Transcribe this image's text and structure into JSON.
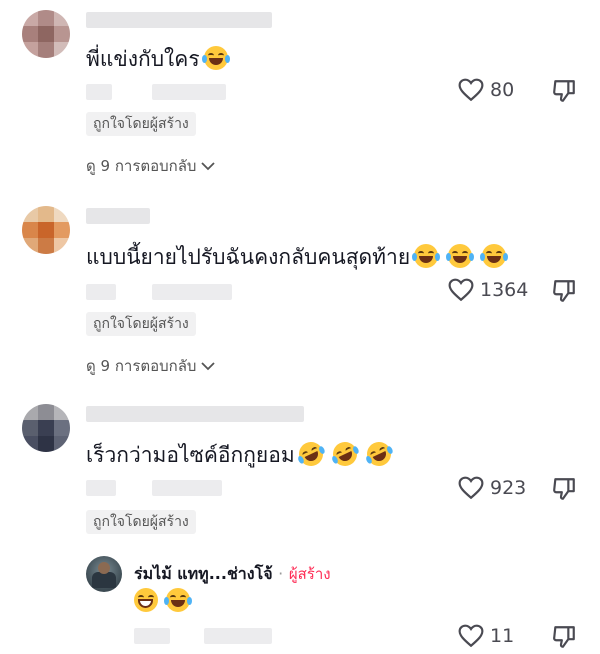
{
  "comments": [
    {
      "text": "พี่แข่งกับใคร",
      "likes": "80",
      "liked_by": "ถูกใจโดยผู้สร้าง",
      "replies": "ดู 9 การตอบกลับ",
      "emojis": [
        "tears-of-joy"
      ]
    },
    {
      "text": "แบบนี้ยายไปรับฉันคงกลับคนสุดท้าย",
      "likes": "1364",
      "liked_by": "ถูกใจโดยผู้สร้าง",
      "replies": "ดู 9 การตอบกลับ",
      "emojis": [
        "tears-of-joy",
        "tears-of-joy",
        "tears-of-joy"
      ]
    },
    {
      "text": "เร็วกว่ามอไซค์อีกกูยอม",
      "likes": "923",
      "liked_by": "ถูกใจโดยผู้สร้าง",
      "emojis": [
        "rofl",
        "rofl",
        "rofl"
      ]
    }
  ],
  "reply": {
    "author": "ร่มไม้ แททู...ช่างโจ้",
    "separator": "·",
    "creator_label": "ผู้สร้าง",
    "likes": "11",
    "emojis": [
      "grinning",
      "tears-of-joy"
    ]
  },
  "colors": {
    "accent": "#fe2c55",
    "text": "#161823",
    "muted": "#555555",
    "badge_bg": "#f1f1f2"
  },
  "icons": [
    "heart-icon",
    "dislike-icon",
    "chevron-down-icon"
  ]
}
